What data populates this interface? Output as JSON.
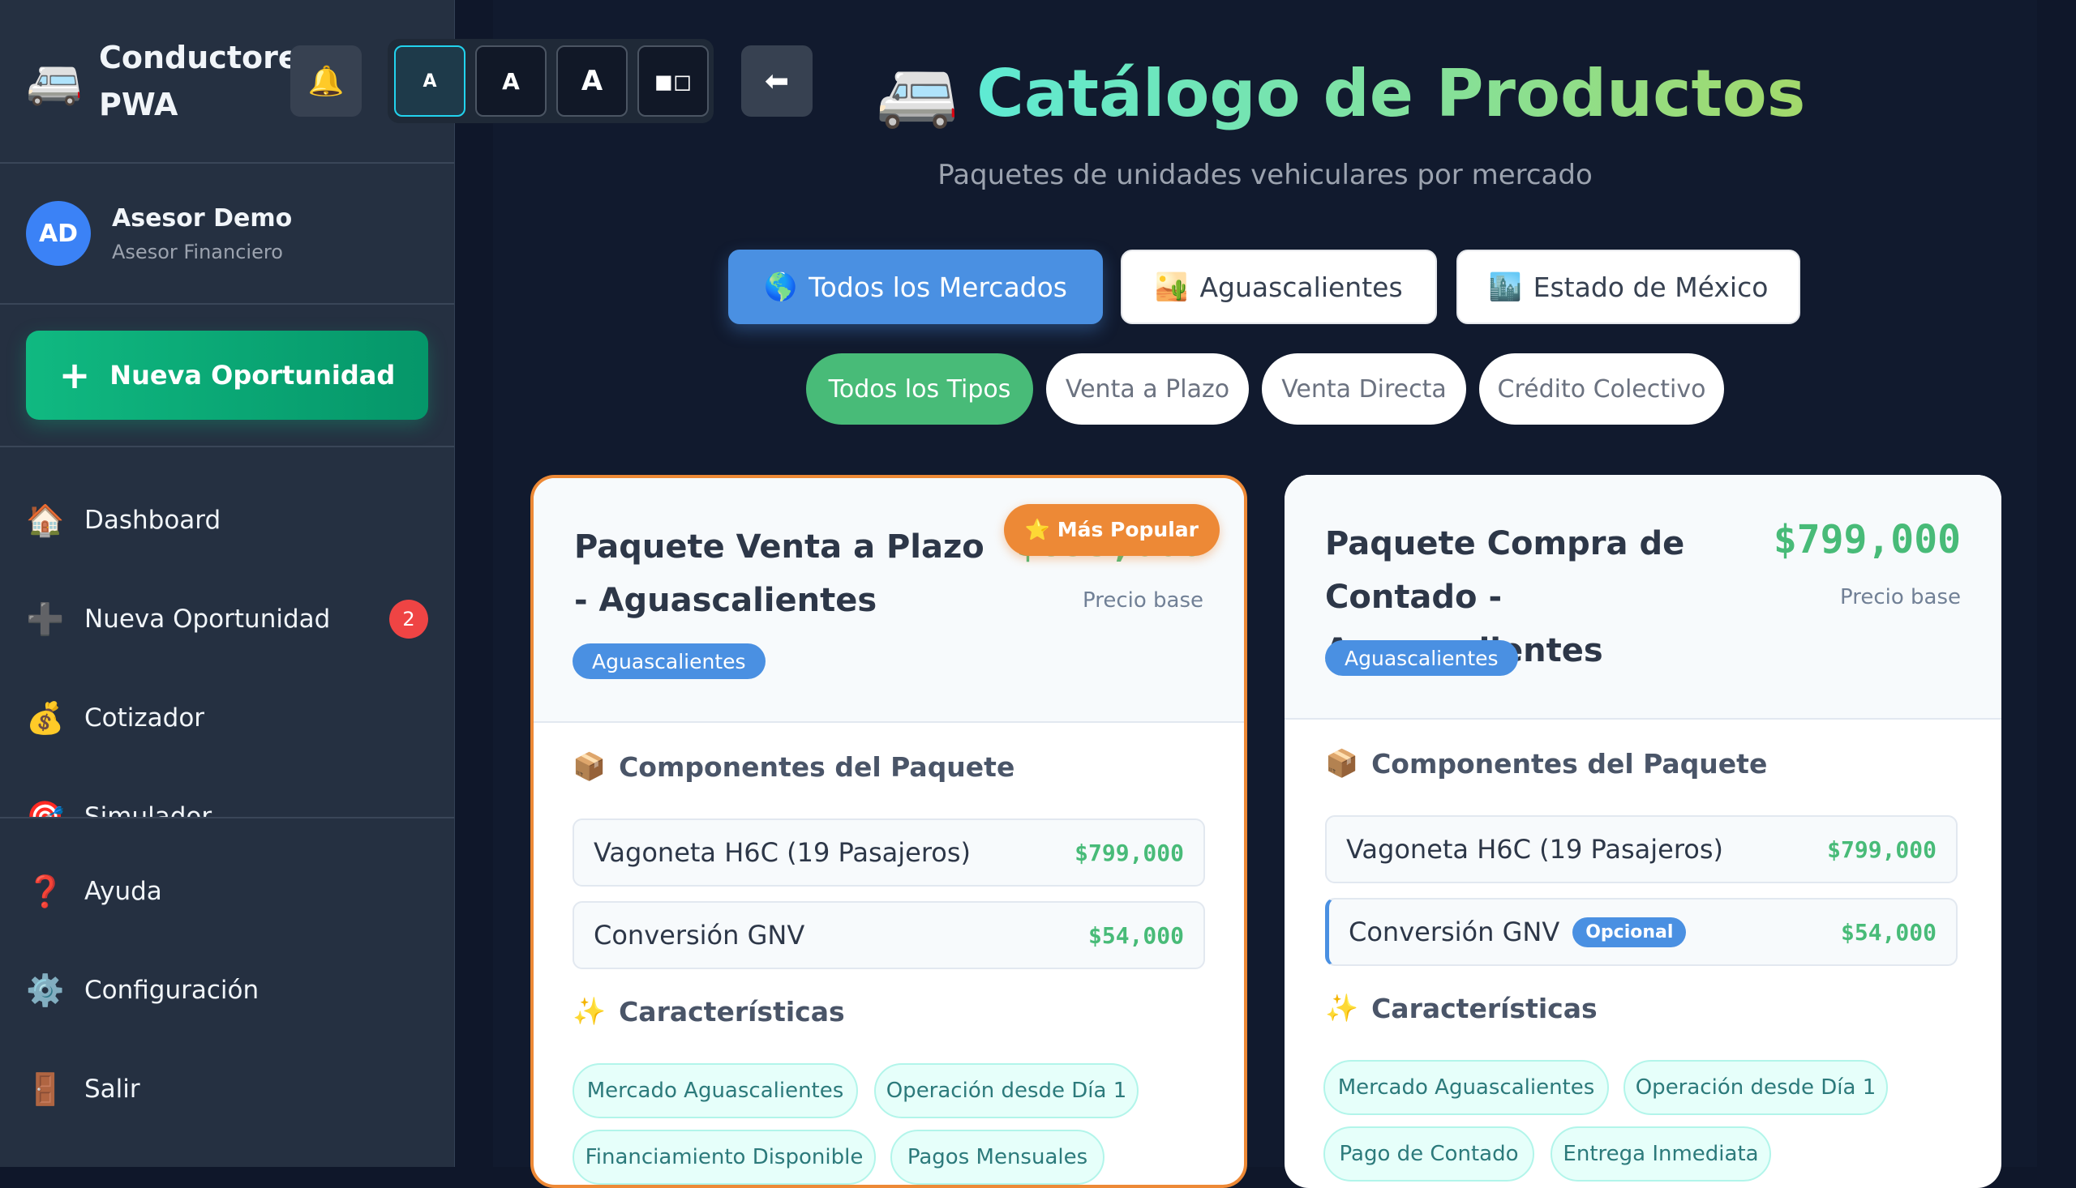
{
  "sidebar": {
    "brand_icon": "🚐",
    "brand_name": "Conductores PWA",
    "user": {
      "initials": "AD",
      "name": "Asesor Demo",
      "role": "Asesor Financiero"
    },
    "new_button": {
      "icon": "+",
      "label": "Nueva Oportunidad"
    },
    "nav": [
      {
        "icon": "🏠",
        "label": "Dashboard"
      },
      {
        "icon": "➕",
        "label": "Nueva Oportunidad",
        "badge": "2"
      },
      {
        "icon": "💰",
        "label": "Cotizador"
      },
      {
        "icon": "🎯",
        "label": "Simulador"
      }
    ],
    "bottom_nav": [
      {
        "icon": "❓",
        "label": "Ayuda"
      },
      {
        "icon": "⚙️",
        "label": "Configuración"
      },
      {
        "icon": "🚪",
        "label": "Salir"
      }
    ]
  },
  "toolbar": {
    "notifications_icon": "🔔",
    "font_sizes": [
      "A",
      "A",
      "A"
    ],
    "contrast_icon": "◼◻",
    "back_icon": "⬅"
  },
  "header": {
    "icon": "🚐",
    "title": "Catálogo de Productos",
    "subtitle": "Paquetes de unidades vehiculares por mercado"
  },
  "market_filters": [
    {
      "icon": "🌎",
      "label": "Todos los Mercados"
    },
    {
      "icon": "🏜️",
      "label": "Aguascalientes"
    },
    {
      "icon": "🏙️",
      "label": "Estado de México"
    }
  ],
  "type_filters": [
    "Todos los Tipos",
    "Venta a Plazo",
    "Venta Directa",
    "Crédito Colectivo"
  ],
  "colors": {
    "accent": "#4a90e2",
    "success": "#48bb78",
    "popular": "#ed8936",
    "sidebar": "#253041",
    "background": "#111a2e"
  },
  "products": [
    {
      "title": "Paquete Venta a Plazo - Aguascalientes",
      "price": "$853,000",
      "price_label": "Precio base",
      "market": "Aguascalientes",
      "popular_badge": "⭐ Más Popular",
      "components_title": "Componentes del Paquete",
      "components_icon": "📦",
      "components": [
        {
          "name": "Vagoneta H6C (19 Pasajeros)",
          "price": "$799,000"
        },
        {
          "name": "Conversión GNV",
          "price": "$54,000"
        }
      ],
      "features_title": "Características",
      "features_icon": "✨",
      "features": [
        "Mercado Aguascalientes",
        "Operación desde Día 1",
        "Financiamiento Disponible",
        "Pagos Mensuales"
      ]
    },
    {
      "title": "Paquete Compra de Contado - Aguascalientes",
      "price": "$799,000",
      "price_label": "Precio base",
      "market": "Aguascalientes",
      "components_title": "Componentes del Paquete",
      "components_icon": "📦",
      "components": [
        {
          "name": "Vagoneta H6C (19 Pasajeros)",
          "price": "$799,000"
        },
        {
          "name": "Conversión GNV",
          "price": "$54,000",
          "badge": "Opcional"
        }
      ],
      "features_title": "Características",
      "features_icon": "✨",
      "features": [
        "Mercado Aguascalientes",
        "Operación desde Día 1",
        "Pago de Contado",
        "Entrega Inmediata"
      ]
    }
  ]
}
